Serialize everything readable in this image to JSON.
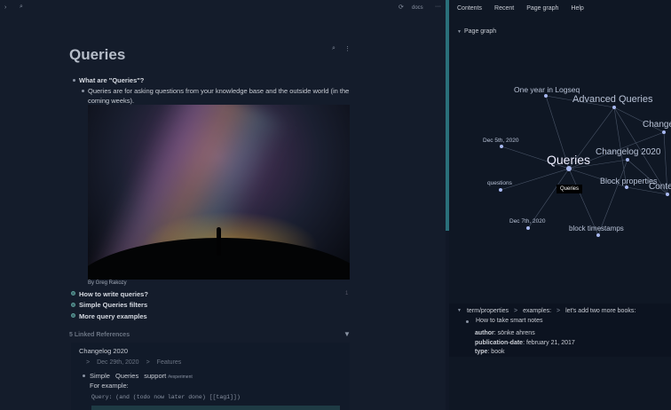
{
  "topbar": {
    "doc_label": "docs",
    "more": "···"
  },
  "page": {
    "title": "Queries",
    "blocks": [
      {
        "text": "What are \"Queries\"?"
      },
      {
        "text": "Queries are for asking questions from your knowledge base and the outside world (in the"
      },
      {
        "text": "coming weeks)."
      },
      {
        "text": "By Greg Rakozy"
      },
      {
        "text": "How to write queries?",
        "count": "1"
      },
      {
        "text": "Simple Queries filters"
      },
      {
        "text": "More query examples"
      }
    ]
  },
  "refs": {
    "header": "5 Linked References",
    "page": "Changelog 2020",
    "crumb1": "Dec 29th, 2020",
    "crumb2": "Features",
    "sep": ">",
    "block": {
      "w1": "Simple",
      "w2": "Queries",
      "w3": "support",
      "tag": "#experiment"
    },
    "example": "For example:",
    "query": "Query: (and (todo now later done) [[tag1]])"
  },
  "sidebar": {
    "tabs": [
      "Contents",
      "Recent",
      "Page graph",
      "Help"
    ],
    "section": "Page graph",
    "graph": {
      "nodes": [
        "One year in Logseq",
        "Advanced Queries",
        "Change",
        "Dec 5th, 2020",
        "Queries",
        "Changelog 2020",
        "questions",
        "Block properties",
        "Conte",
        "Dec 7th, 2020",
        "block timestamps"
      ],
      "tooltip": "Queries"
    },
    "breadcrumb": [
      "term/properties",
      "examples:",
      "let's add two more books:"
    ],
    "book": "How to take smart notes",
    "props": [
      {
        "k": "author",
        "v": "sönke ahrens"
      },
      {
        "k": "publication-date",
        "v": "february 21, 2017"
      },
      {
        "k": "type",
        "v": "book"
      }
    ]
  }
}
